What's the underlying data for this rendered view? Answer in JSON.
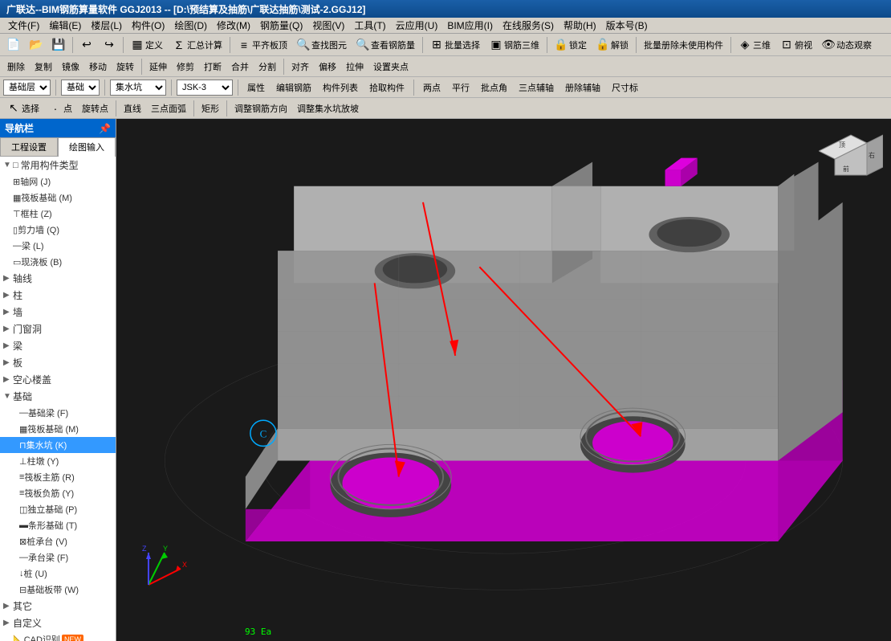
{
  "title": "广联达--BIM钢筋算量软件 GGJ2013 -- [D:\\预结算及抽筋\\广联达抽筋\\测试-2.GGJ12]",
  "menu": {
    "items": [
      "文件(F)",
      "编辑(E)",
      "楼层(L)",
      "构件(O)",
      "绘图(D)",
      "修改(M)",
      "钢筋量(Q)",
      "视图(V)",
      "工具(T)",
      "云应用(U)",
      "BIM应用(I)",
      "在线服务(S)",
      "帮助(H)",
      "版本号(B)"
    ]
  },
  "toolbar1": {
    "buttons": [
      "新建",
      "打开",
      "保存",
      "撤销",
      "重做",
      "定义",
      "汇总计算",
      "平齐板顶",
      "查找图元",
      "查看钢筋量",
      "批量选择",
      "钢筋三维",
      "锁定",
      "解锁",
      "批量册除未使用构件",
      "三维",
      "俯视",
      "动态观察"
    ]
  },
  "toolbar2": {
    "breadcrumb": [
      "基础层",
      "基础"
    ],
    "component_type": "集水坑",
    "component_name": "JSK-3",
    "buttons": [
      "属性",
      "编辑钢筋",
      "构件列表",
      "拾取构件",
      "两点",
      "平行",
      "批点角",
      "三点辅轴",
      "册除辅轴",
      "尺寸标"
    ]
  },
  "toolbar3": {
    "buttons": [
      "选择",
      "点",
      "旋转点",
      "直线",
      "三点面弧",
      "矩形",
      "调整钢筋方向",
      "调整集水坑放坡"
    ]
  },
  "toolbar4": {
    "buttons": [
      "删除",
      "复制",
      "镜像",
      "移动",
      "旋转",
      "延伸",
      "修剪",
      "打断",
      "合并",
      "分割",
      "对齐",
      "偏移",
      "拉伸",
      "设置夹点"
    ]
  },
  "sidebar": {
    "header": "导航栏",
    "tabs": [
      "工程设置",
      "绘图输入"
    ],
    "active_tab": "绘图输入",
    "tree": [
      {
        "type": "category",
        "label": "常用构件类型",
        "expanded": true
      },
      {
        "type": "item",
        "label": "轴网 (J)",
        "icon": "grid",
        "indent": 1
      },
      {
        "type": "item",
        "label": "筏板基础 (M)",
        "icon": "foundation",
        "indent": 1
      },
      {
        "type": "item",
        "label": "框柱 (Z)",
        "icon": "column",
        "indent": 1
      },
      {
        "type": "item",
        "label": "剪力墙 (Q)",
        "icon": "wall",
        "indent": 1
      },
      {
        "type": "item",
        "label": "梁 (L)",
        "icon": "beam",
        "indent": 1
      },
      {
        "type": "item",
        "label": "现浇板 (B)",
        "icon": "slab",
        "indent": 1
      },
      {
        "type": "category",
        "label": "轴线",
        "expanded": false
      },
      {
        "type": "category",
        "label": "柱",
        "expanded": false
      },
      {
        "type": "category",
        "label": "墙",
        "expanded": false
      },
      {
        "type": "category",
        "label": "门窗洞",
        "expanded": false
      },
      {
        "type": "category",
        "label": "梁",
        "expanded": false
      },
      {
        "type": "category",
        "label": "板",
        "expanded": false
      },
      {
        "type": "category",
        "label": "空心楼盖",
        "expanded": false
      },
      {
        "type": "category",
        "label": "基础",
        "expanded": true
      },
      {
        "type": "item",
        "label": "基础梁 (F)",
        "icon": "beam",
        "indent": 2
      },
      {
        "type": "item",
        "label": "筏板基础 (M)",
        "icon": "foundation",
        "indent": 2
      },
      {
        "type": "item",
        "label": "集水坑 (K)",
        "icon": "pit",
        "indent": 2,
        "selected": true
      },
      {
        "type": "item",
        "label": "柱墩 (Y)",
        "icon": "pier",
        "indent": 2
      },
      {
        "type": "item",
        "label": "筏板主筋 (R)",
        "icon": "rebar",
        "indent": 2
      },
      {
        "type": "item",
        "label": "筏板负筋 (Y)",
        "icon": "rebar",
        "indent": 2
      },
      {
        "type": "item",
        "label": "独立基础 (P)",
        "icon": "foundation",
        "indent": 2
      },
      {
        "type": "item",
        "label": "条形基础 (T)",
        "icon": "foundation",
        "indent": 2
      },
      {
        "type": "item",
        "label": "桩承台 (V)",
        "icon": "pile",
        "indent": 2
      },
      {
        "type": "item",
        "label": "承台梁 (F)",
        "icon": "beam",
        "indent": 2
      },
      {
        "type": "item",
        "label": "桩 (U)",
        "icon": "pile",
        "indent": 2
      },
      {
        "type": "item",
        "label": "基础板带 (W)",
        "icon": "band",
        "indent": 2
      },
      {
        "type": "category",
        "label": "其它",
        "expanded": false
      },
      {
        "type": "category",
        "label": "自定义",
        "expanded": false
      },
      {
        "type": "item",
        "label": "CAD识别",
        "icon": "cad",
        "indent": 0,
        "badge": "NEW"
      }
    ]
  },
  "scene": {
    "background": "#1a1a1a",
    "model_color": "#808080",
    "accent_color": "#cc00cc"
  },
  "statusbar": {
    "coords": "93 Ea"
  }
}
